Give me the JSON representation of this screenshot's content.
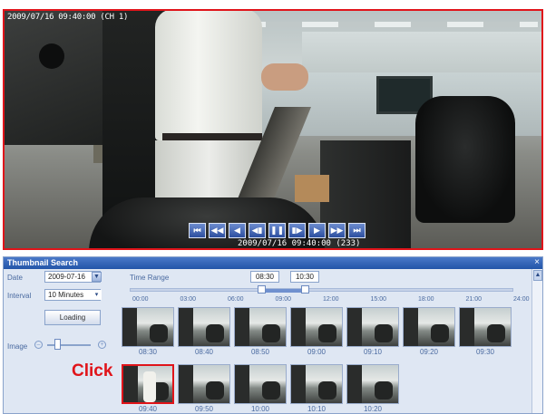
{
  "video": {
    "osd_title": "2009/07/16 09:40:00 (CH 1)",
    "timestamp": "2009/07/16 09:40:00 (233)",
    "controls": [
      {
        "name": "first-frame-button",
        "glyph": "⏮"
      },
      {
        "name": "fast-rewind-button",
        "glyph": "◀◀"
      },
      {
        "name": "step-back-button",
        "glyph": "◀"
      },
      {
        "name": "reverse-play-button",
        "glyph": "◀▮"
      },
      {
        "name": "pause-button",
        "glyph": "❚❚"
      },
      {
        "name": "play-step-button",
        "glyph": "▮▶"
      },
      {
        "name": "step-forward-button",
        "glyph": "▶"
      },
      {
        "name": "fast-forward-button",
        "glyph": "▶▶"
      },
      {
        "name": "last-frame-button",
        "glyph": "⏭"
      }
    ]
  },
  "panel": {
    "title": "Thumbnail Search",
    "close": "×",
    "date_label": "Date",
    "date_value": "2009-07-16",
    "interval_label": "Interval",
    "interval_value": "10 Minutes",
    "loading_label": "Loading",
    "image_label": "Image",
    "zoom_out": "–",
    "zoom_in": "+",
    "time_range_label": "Time Range",
    "time_from": "08:30",
    "time_to": "10:30",
    "ticks": [
      "00:00",
      "03:00",
      "06:00",
      "09:00",
      "12:00",
      "15:00",
      "18:00",
      "21:00",
      "24:00"
    ]
  },
  "thumbnails": {
    "row1": [
      "08:30",
      "08:40",
      "08:50",
      "09:00",
      "09:10",
      "09:20",
      "09:30"
    ],
    "row2": [
      "09:40",
      "09:50",
      "10:00",
      "10:10",
      "10:20"
    ],
    "selected": "09:40"
  },
  "annotation": {
    "click": "Click"
  },
  "colors": {
    "highlight": "#e0141a",
    "panel_title": "#2255a8",
    "panel_bg": "#dfe7f3"
  }
}
